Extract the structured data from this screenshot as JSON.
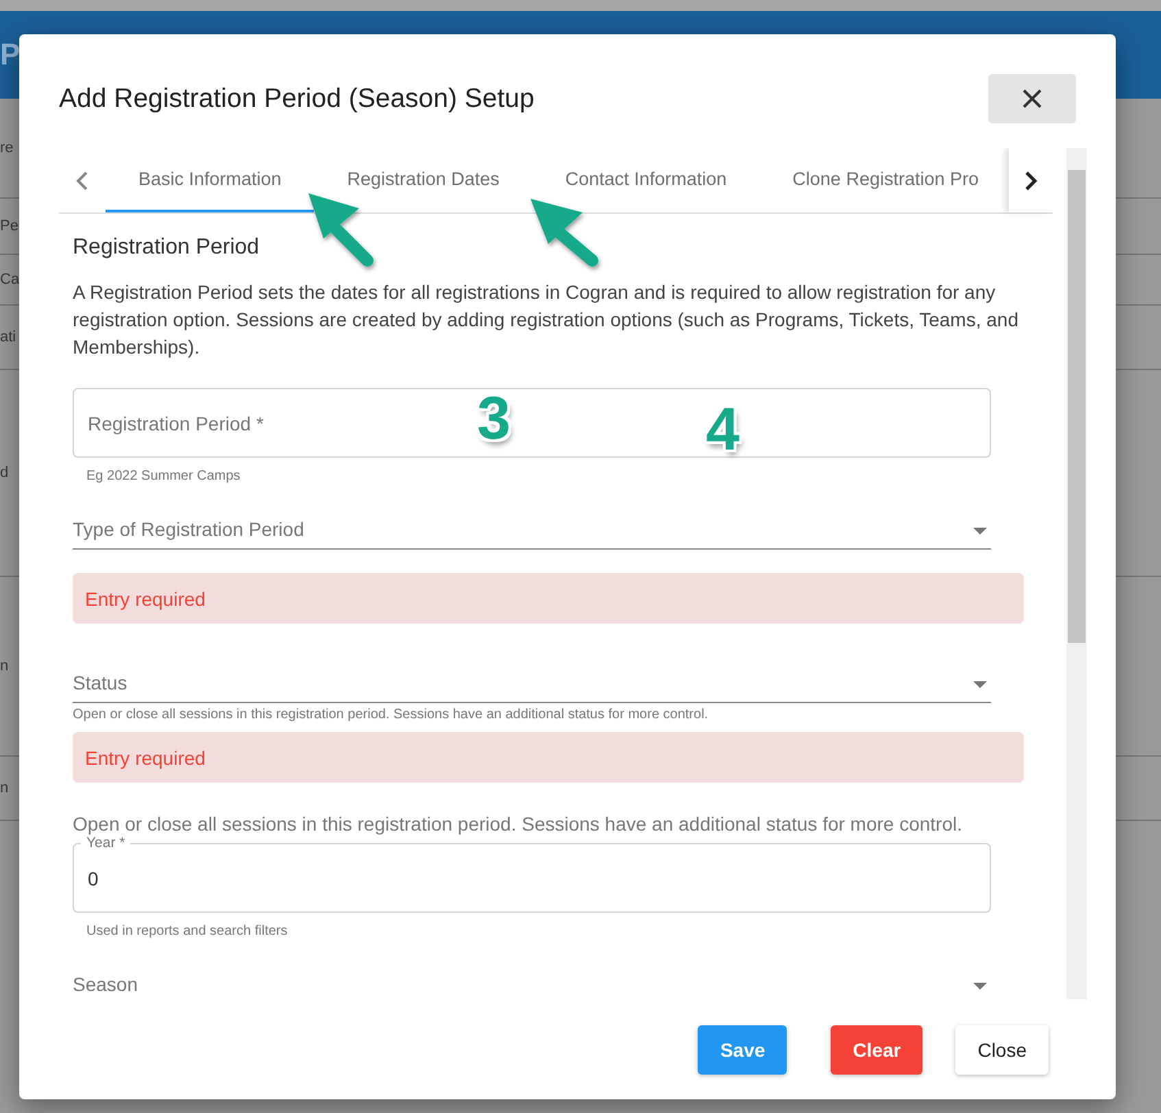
{
  "background_page": {
    "header_text": "P",
    "fragments": [
      "re",
      "Pe",
      "Ca",
      "ati",
      "d",
      "n",
      "n"
    ]
  },
  "dialog": {
    "title": "Add Registration Period (Season) Setup"
  },
  "tabs": [
    {
      "label": "Basic Information",
      "selected": true
    },
    {
      "label": "Registration Dates",
      "selected": false
    },
    {
      "label": "Contact Information",
      "selected": false
    },
    {
      "label": "Clone Registration Pro",
      "selected": false
    }
  ],
  "form": {
    "section_title": "Registration Period",
    "intro": "A Registration Period sets the dates for all registrations in Cogran and is required to allow registration for any registration option. Sessions are created by adding registration options (such as Programs, Tickets, Teams, and Memberships).",
    "fields": [
      {
        "kind": "outlined",
        "placeholder": "Registration Period *",
        "helper": "Eg 2022 Summer Camps"
      },
      {
        "kind": "select",
        "label": "Type of Registration Period"
      },
      {
        "kind": "error",
        "text": "Entry required"
      },
      {
        "kind": "select",
        "label": "Status",
        "helper": "Open or close all sessions in this registration period. Sessions have an additional status for more control."
      },
      {
        "kind": "error",
        "text": "Entry required"
      },
      {
        "kind": "note",
        "text": "Open or close all sessions in this registration period. Sessions have an additional status for more control."
      },
      {
        "kind": "outlined",
        "label": "Year *",
        "value": "0",
        "helper": "Used in reports and search filters"
      },
      {
        "kind": "select",
        "label": "Season"
      }
    ]
  },
  "buttons": [
    {
      "label": "Save",
      "kind": "primary"
    },
    {
      "label": "Clear",
      "kind": "danger"
    },
    {
      "label": "Close",
      "kind": "default"
    }
  ],
  "annotations": [
    {
      "label": "3"
    },
    {
      "label": "4"
    }
  ]
}
